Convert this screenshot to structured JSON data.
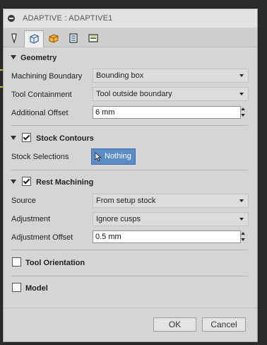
{
  "window": {
    "title": "ADAPTIVE : ADAPTIVE1"
  },
  "tabs": [
    {
      "icon": "tool-icon"
    },
    {
      "icon": "geometry-icon"
    },
    {
      "icon": "heights-icon"
    },
    {
      "icon": "passes-icon"
    },
    {
      "icon": "linking-icon"
    }
  ],
  "geometry": {
    "title": "Geometry",
    "machining_boundary": {
      "label": "Machining Boundary",
      "value": "Bounding box"
    },
    "tool_containment": {
      "label": "Tool Containment",
      "value": "Tool outside boundary"
    },
    "additional_offset": {
      "label": "Additional Offset",
      "value": "6 mm"
    }
  },
  "stock_contours": {
    "title": "Stock Contours",
    "checked": true,
    "stock_selections": {
      "label": "Stock Selections",
      "value": "Nothing"
    }
  },
  "rest_machining": {
    "title": "Rest Machining",
    "checked": true,
    "source": {
      "label": "Source",
      "value": "From setup stock"
    },
    "adjustment": {
      "label": "Adjustment",
      "value": "Ignore cusps"
    },
    "adjustment_offset": {
      "label": "Adjustment Offset",
      "value": "0.5 mm"
    }
  },
  "tool_orientation": {
    "title": "Tool Orientation",
    "checked": false
  },
  "model": {
    "title": "Model",
    "checked": false
  },
  "buttons": {
    "ok": "OK",
    "cancel": "Cancel"
  },
  "colors": {
    "accent": "#5a8cc6",
    "dialog_bg": "#d5d5d5"
  }
}
